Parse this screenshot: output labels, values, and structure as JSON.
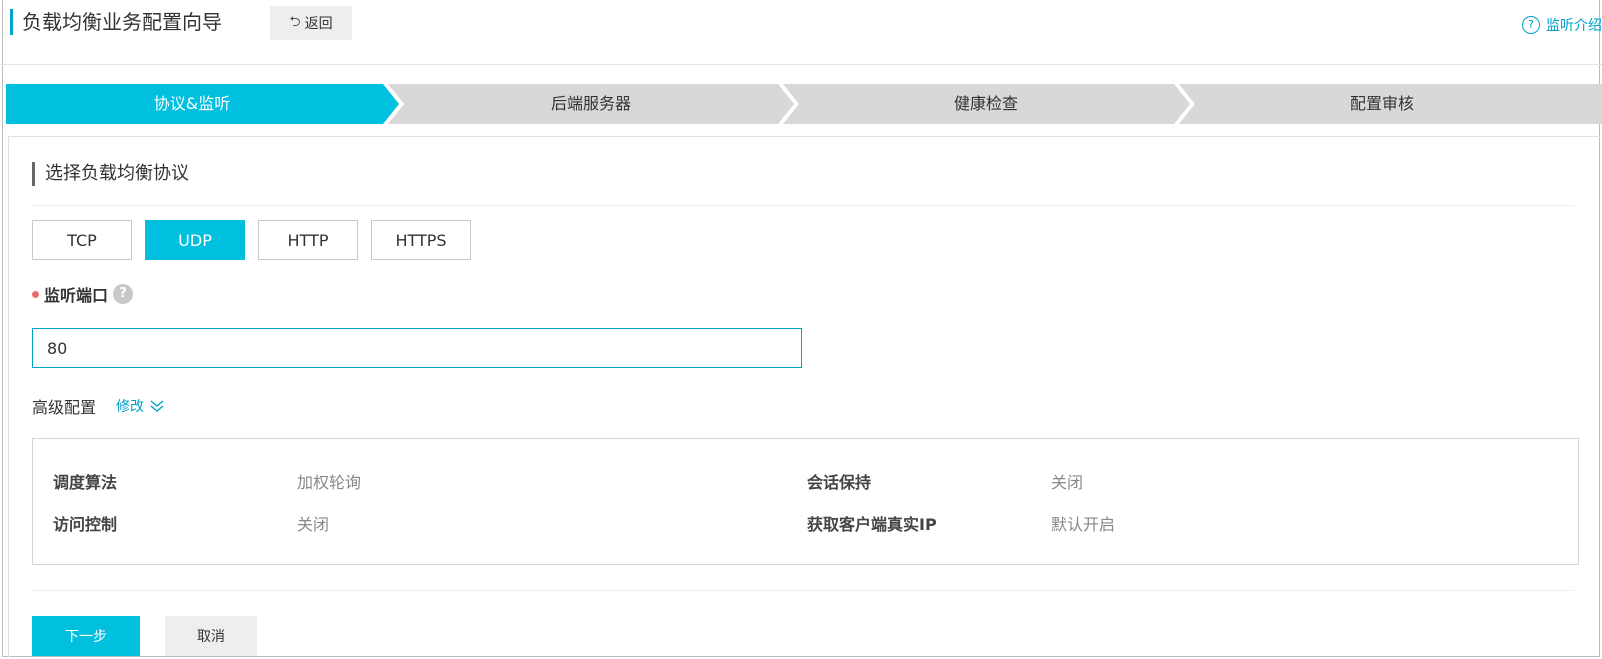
{
  "header": {
    "title": "负载均衡业务配置向导",
    "back_label": "返回",
    "help_label": "监听介绍"
  },
  "steps": [
    {
      "label": "协议&监听",
      "active": true
    },
    {
      "label": "后端服务器",
      "active": false
    },
    {
      "label": "健康检查",
      "active": false
    },
    {
      "label": "配置审核",
      "active": false
    }
  ],
  "section": {
    "title": "选择负载均衡协议"
  },
  "protocols": [
    {
      "label": "TCP",
      "selected": false
    },
    {
      "label": "UDP",
      "selected": true
    },
    {
      "label": "HTTP",
      "selected": false
    },
    {
      "label": "HTTPS",
      "selected": false
    }
  ],
  "listen_port": {
    "label": "监听端口",
    "help": "?",
    "value": "80"
  },
  "advanced": {
    "label": "高级配置",
    "modify_label": "修改",
    "items": [
      {
        "key": "调度算法",
        "value": "加权轮询"
      },
      {
        "key": "会话保持",
        "value": "关闭"
      },
      {
        "key": "访问控制",
        "value": "关闭"
      },
      {
        "key": "获取客户端真实IP",
        "value": "默认开启"
      }
    ]
  },
  "actions": {
    "next_label": "下一步",
    "cancel_label": "取消"
  },
  "colors": {
    "accent": "#00bfdf",
    "link": "#00a2ca",
    "step_inactive": "#d8d8d8"
  }
}
